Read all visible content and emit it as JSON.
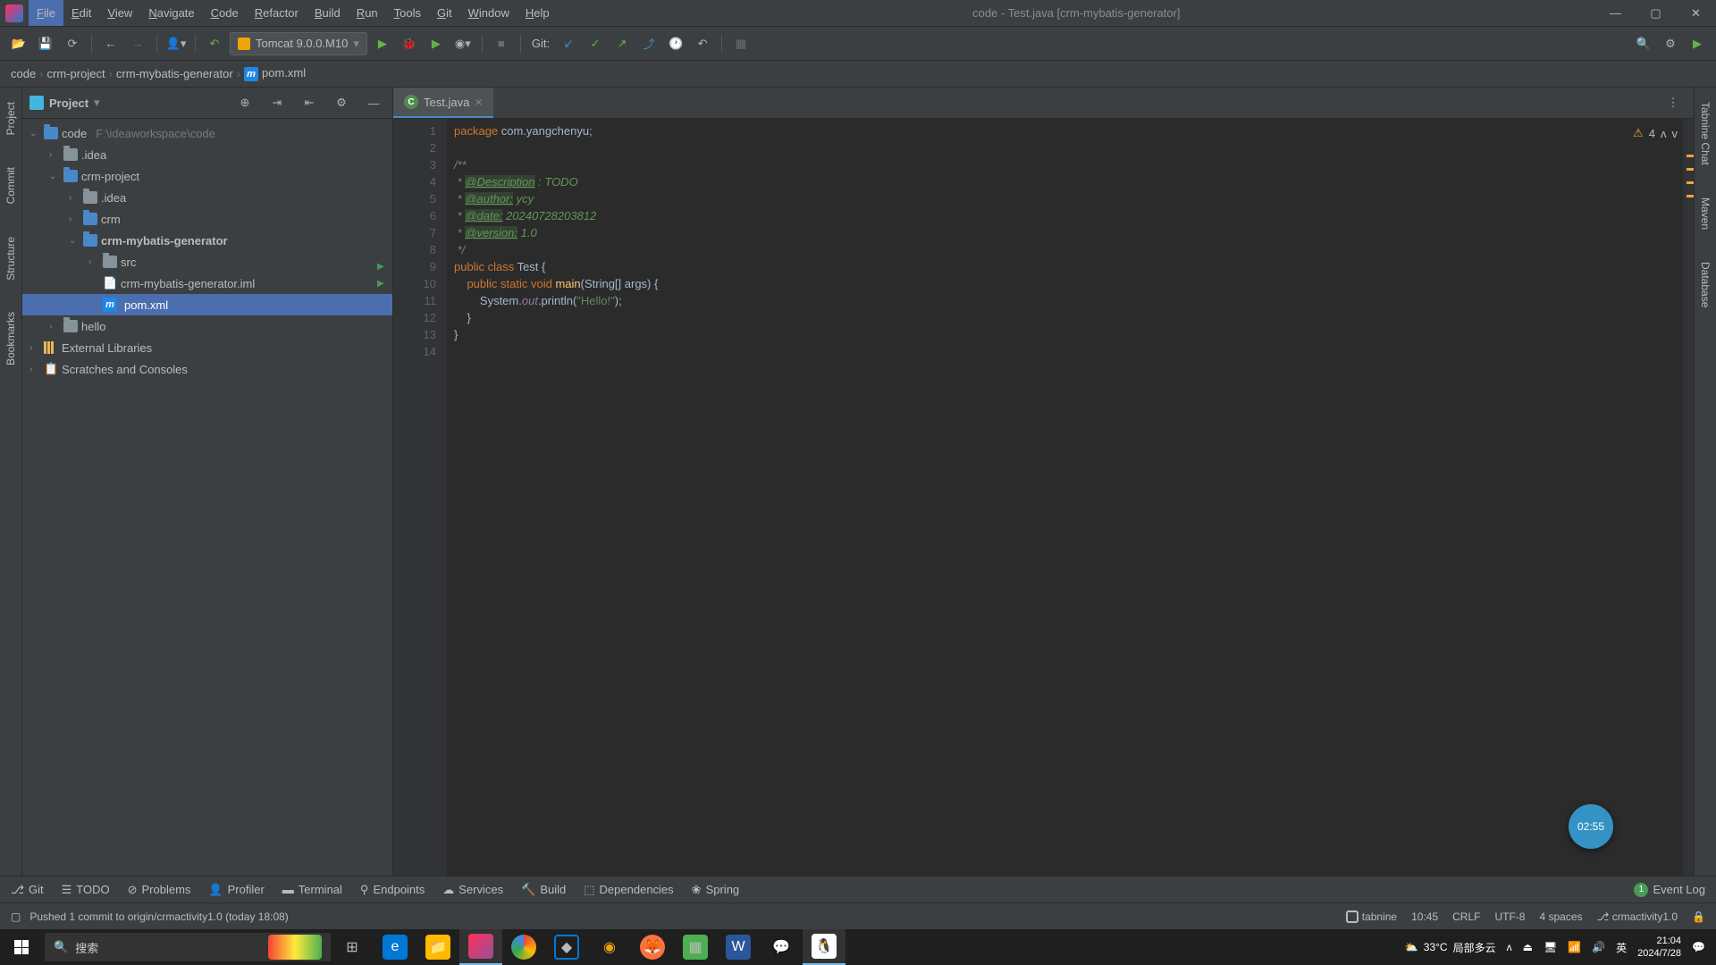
{
  "title": "code - Test.java [crm-mybatis-generator]",
  "menu": [
    "File",
    "Edit",
    "View",
    "Navigate",
    "Code",
    "Refactor",
    "Build",
    "Run",
    "Tools",
    "Git",
    "Window",
    "Help"
  ],
  "menu_active_index": 0,
  "run_config": "Tomcat 9.0.0.M10",
  "git_label": "Git:",
  "breadcrumb": {
    "items": [
      "code",
      "crm-project",
      "crm-mybatis-generator"
    ],
    "file": "pom.xml"
  },
  "project_panel": {
    "title": "Project",
    "tree": {
      "root": {
        "label": "code",
        "hint": "F:\\ideaworkspace\\code"
      },
      "nodes": [
        {
          "indent": 1,
          "arrow": "›",
          "icon": "folder",
          "label": ".idea"
        },
        {
          "indent": 1,
          "arrow": "⌄",
          "icon": "folder-mod",
          "label": "crm-project"
        },
        {
          "indent": 2,
          "arrow": "›",
          "icon": "folder",
          "label": ".idea"
        },
        {
          "indent": 2,
          "arrow": "›",
          "icon": "folder-mod",
          "label": "crm"
        },
        {
          "indent": 2,
          "arrow": "⌄",
          "icon": "folder-mod",
          "label": "crm-mybatis-generator",
          "bold": true
        },
        {
          "indent": 3,
          "arrow": "›",
          "icon": "folder",
          "label": "src"
        },
        {
          "indent": 3,
          "arrow": "",
          "icon": "file",
          "label": "crm-mybatis-generator.iml"
        },
        {
          "indent": 3,
          "arrow": "",
          "icon": "m",
          "label": "pom.xml",
          "selected": true
        },
        {
          "indent": 1,
          "arrow": "›",
          "icon": "folder",
          "label": "hello"
        }
      ],
      "ext_lib": "External Libraries",
      "scratches": "Scratches and Consoles"
    }
  },
  "tabs": [
    {
      "label": "Test.java",
      "icon": "class"
    }
  ],
  "inspections": {
    "warnings": 4
  },
  "code_lines": [
    {
      "n": 1,
      "tokens": [
        {
          "t": "package ",
          "c": "kw"
        },
        {
          "t": "com.yangchenyu;",
          "c": ""
        }
      ]
    },
    {
      "n": 2,
      "tokens": []
    },
    {
      "n": 3,
      "tokens": [
        {
          "t": "/**",
          "c": "comment"
        }
      ]
    },
    {
      "n": 4,
      "tokens": [
        {
          "t": " * ",
          "c": "comment"
        },
        {
          "t": "@Description",
          "c": "doc-tag"
        },
        {
          "t": " : TODO",
          "c": "doc"
        }
      ]
    },
    {
      "n": 5,
      "tokens": [
        {
          "t": " * ",
          "c": "comment"
        },
        {
          "t": "@author:",
          "c": "doc-tag"
        },
        {
          "t": " ycy",
          "c": "doc"
        }
      ]
    },
    {
      "n": 6,
      "tokens": [
        {
          "t": " * ",
          "c": "comment"
        },
        {
          "t": "@date:",
          "c": "doc-tag"
        },
        {
          "t": " 20240728203812",
          "c": "doc"
        }
      ]
    },
    {
      "n": 7,
      "tokens": [
        {
          "t": " * ",
          "c": "comment"
        },
        {
          "t": "@version:",
          "c": "doc-tag"
        },
        {
          "t": " 1.0",
          "c": "doc"
        }
      ]
    },
    {
      "n": 8,
      "tokens": [
        {
          "t": " */",
          "c": "comment"
        }
      ]
    },
    {
      "n": 9,
      "run": true,
      "tokens": [
        {
          "t": "public class ",
          "c": "kw"
        },
        {
          "t": "Test {",
          "c": ""
        }
      ]
    },
    {
      "n": 10,
      "run": true,
      "tokens": [
        {
          "t": "    public static void ",
          "c": "kw"
        },
        {
          "t": "main",
          "c": "fn"
        },
        {
          "t": "(String[] args) {",
          "c": ""
        }
      ]
    },
    {
      "n": 11,
      "tokens": [
        {
          "t": "        System.",
          "c": ""
        },
        {
          "t": "out",
          "c": "field"
        },
        {
          "t": ".println(",
          "c": ""
        },
        {
          "t": "\"Hello!\"",
          "c": "str"
        },
        {
          "t": ");",
          "c": ""
        }
      ]
    },
    {
      "n": 12,
      "tokens": [
        {
          "t": "    }",
          "c": ""
        }
      ]
    },
    {
      "n": 13,
      "tokens": [
        {
          "t": "}",
          "c": ""
        }
      ]
    },
    {
      "n": 14,
      "tokens": []
    }
  ],
  "overlay_timer": "02:55",
  "bottom_tabs": [
    "Git",
    "TODO",
    "Problems",
    "Profiler",
    "Terminal",
    "Endpoints",
    "Services",
    "Build",
    "Dependencies",
    "Spring"
  ],
  "event_log": {
    "count": 1,
    "label": "Event Log"
  },
  "status": {
    "message": "Pushed 1 commit to origin/crmactivity1.0 (today 18:08)",
    "tabnine": "tabnine",
    "pos": "10:45",
    "sep": "CRLF",
    "enc": "UTF-8",
    "indent": "4 spaces",
    "branch": "crmactivity1.0"
  },
  "left_gutter": [
    "Project",
    "Commit",
    "Structure",
    "Bookmarks"
  ],
  "right_gutter": [
    "Tabnine Chat",
    "Maven",
    "Database"
  ],
  "taskbar": {
    "search_placeholder": "搜索",
    "weather": {
      "temp": "33°C",
      "desc": "局部多云"
    },
    "ime": "英",
    "time": "21:04",
    "date": "2024/7/28"
  }
}
